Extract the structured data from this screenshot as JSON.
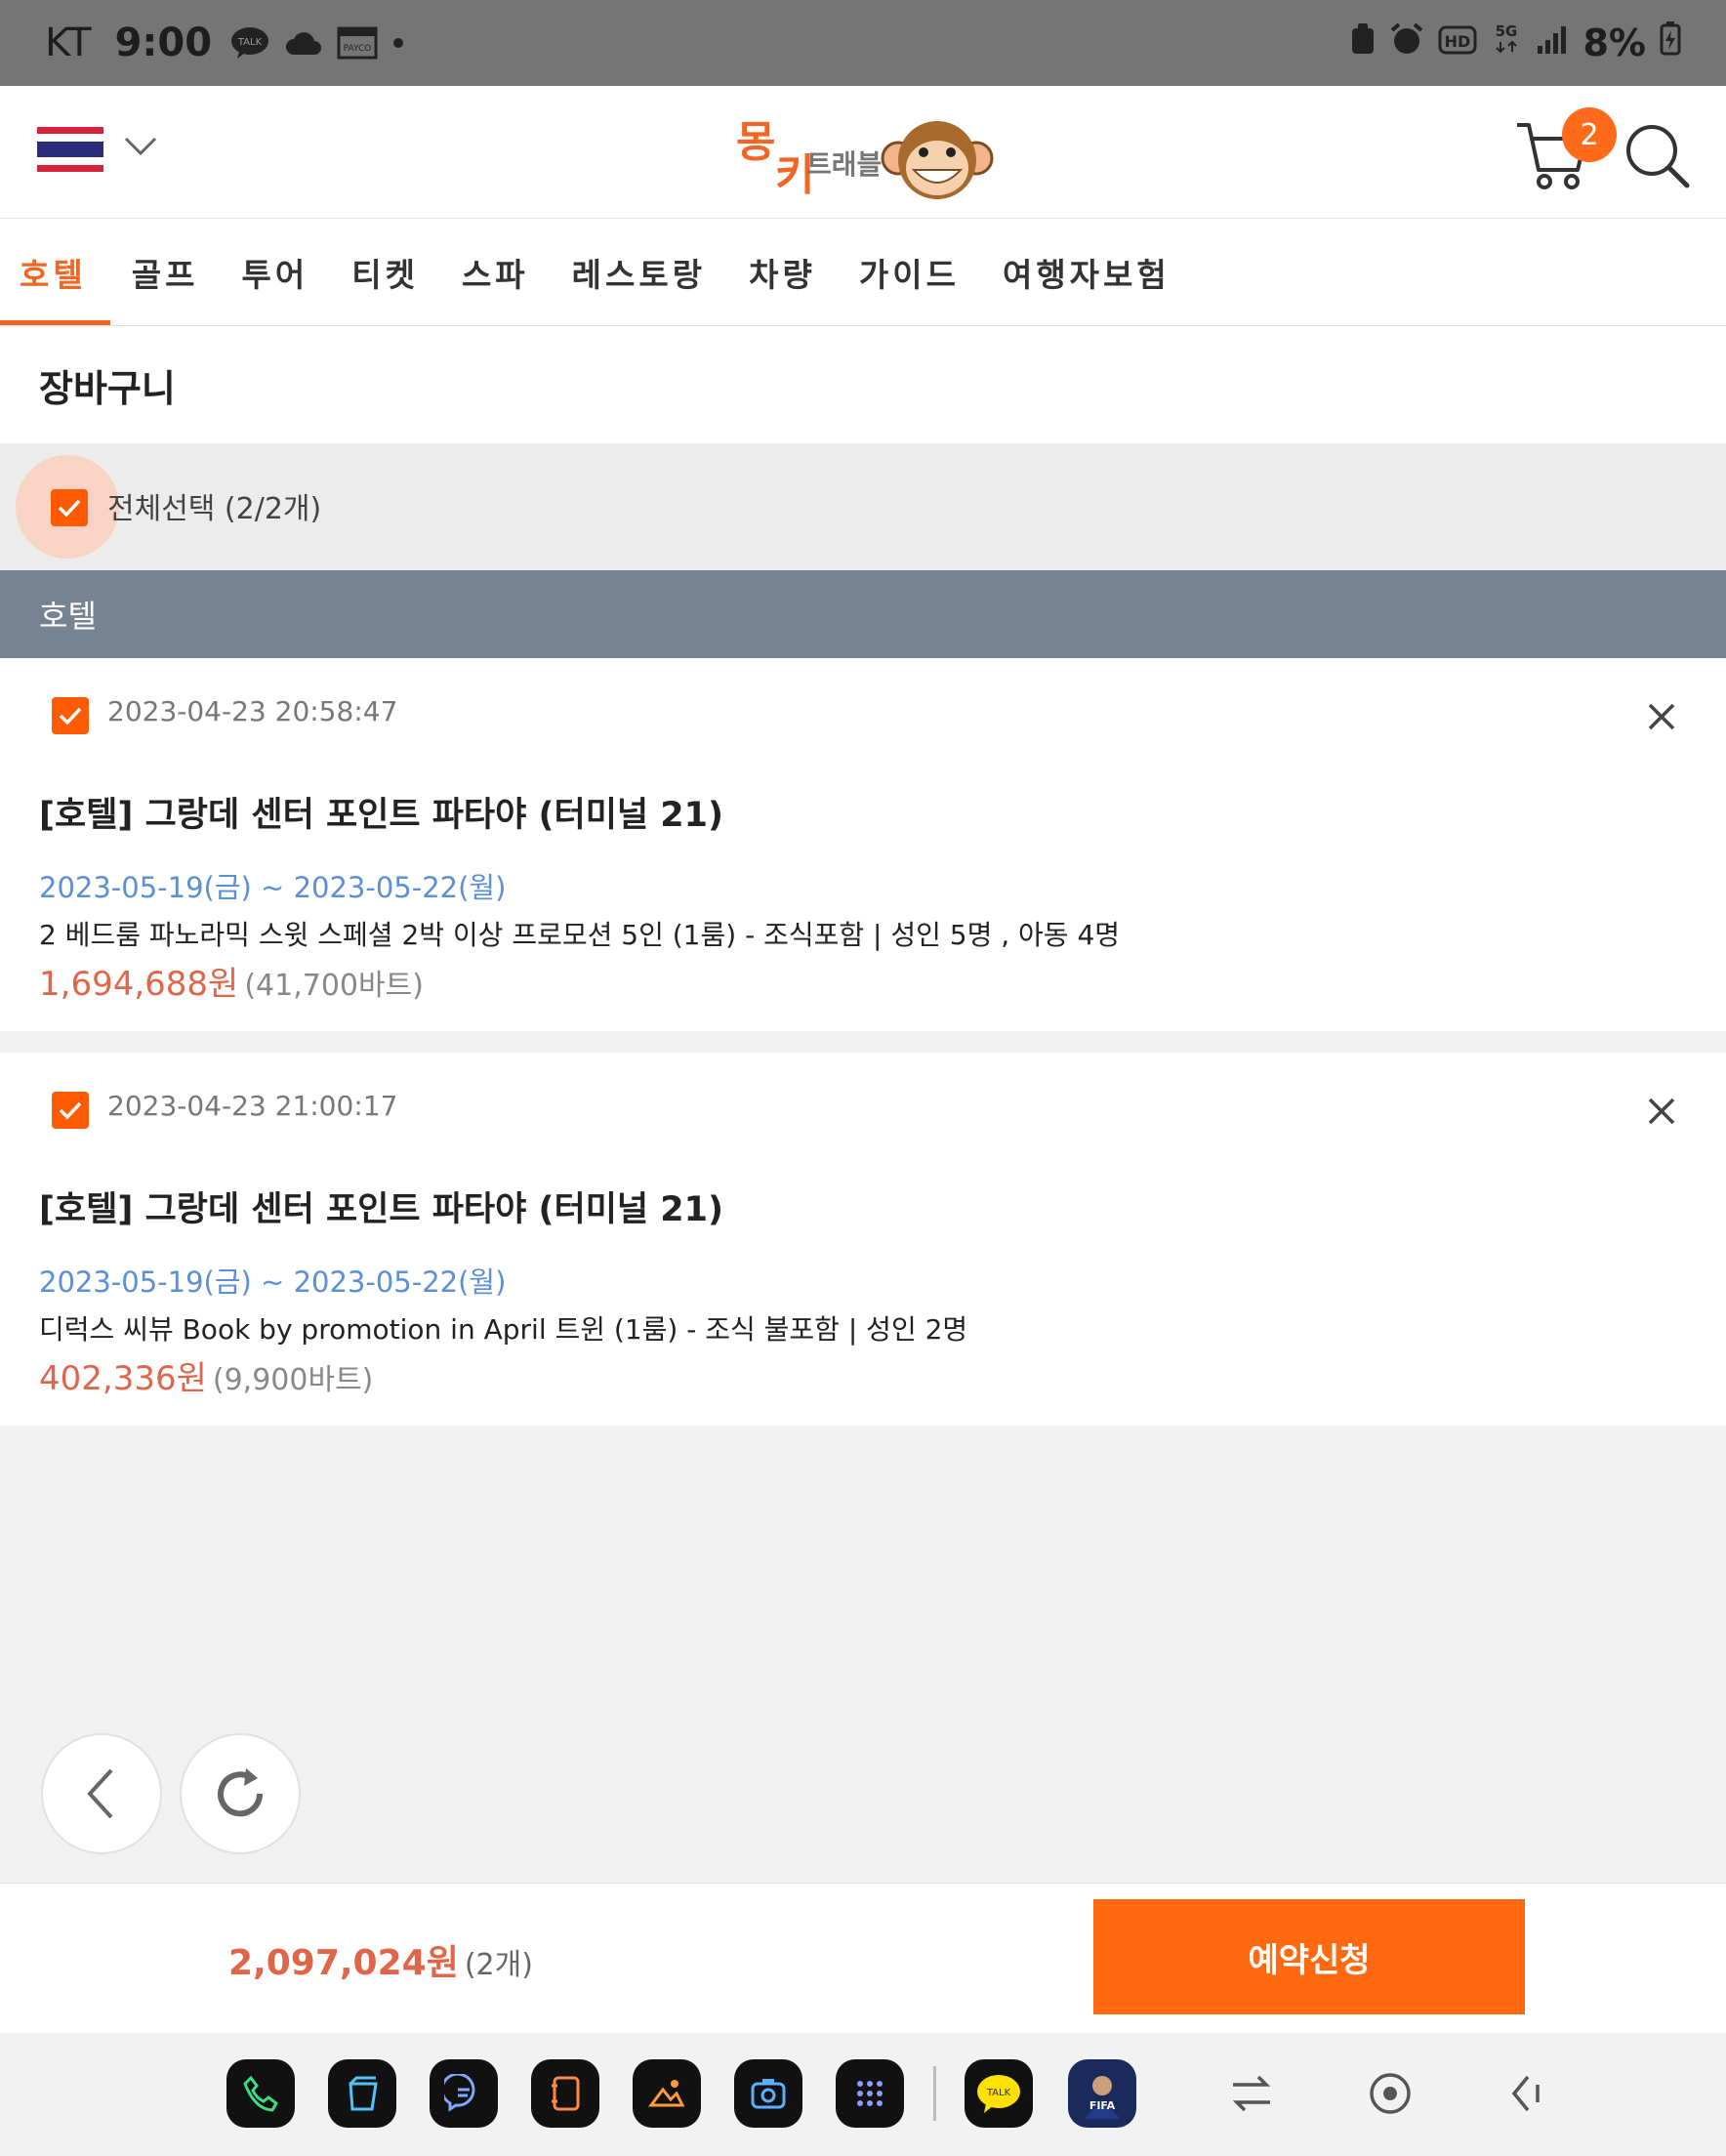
{
  "status_bar": {
    "carrier": "KT",
    "time": "9:00",
    "battery": "8%"
  },
  "header": {
    "cart_count": "2",
    "logo_text": "몽키트래블"
  },
  "tabs": [
    "호텔",
    "골프",
    "투어",
    "티켓",
    "스파",
    "레스토랑",
    "차량",
    "가이드",
    "여행자보험"
  ],
  "page": {
    "title": "장바구니",
    "select_all": "전체선택 (2/2개)",
    "section": "호텔"
  },
  "items": [
    {
      "added": "2023-04-23 20:58:47",
      "name": "[호텔] 그랑데 센터 포인트 파타야 (터미널 21)",
      "dates": "2023-05-19(금) ~ 2023-05-22(월)",
      "desc": "2 베드룸 파노라믹 스윗 스페셜 2박 이상 프로모션 5인 (1룸) - 조식포함 | 성인 5명 , 아동 4명",
      "price": "1,694,688원",
      "baht": "(41,700바트)"
    },
    {
      "added": "2023-04-23 21:00:17",
      "name": "[호텔] 그랑데 센터 포인트 파타야 (터미널 21)",
      "dates": "2023-05-19(금) ~ 2023-05-22(월)",
      "desc": "디럭스 씨뷰 Book by promotion in April 트윈 (1룸) - 조식 불포함 | 성인 2명",
      "price": "402,336원",
      "baht": "(9,900바트)"
    }
  ],
  "total": {
    "amount": "2,097,024원",
    "count": "(2개)",
    "button": "예약신청"
  },
  "colors": {
    "accent": "#ff6a10",
    "section_bg": "#778392",
    "date_blue": "#5b8fd6",
    "price_red": "#e0664a"
  },
  "icons": [
    "talk-icon",
    "cloud-icon",
    "payco-icon",
    "alarm-icon",
    "hd-icon",
    "5g-icon",
    "signal-icon",
    "battery-icon",
    "thai-flag-icon",
    "chevron-down-icon",
    "monkey-logo-icon",
    "cart-icon",
    "search-icon",
    "checkbox-icon",
    "close-icon",
    "back-icon",
    "refresh-icon"
  ]
}
